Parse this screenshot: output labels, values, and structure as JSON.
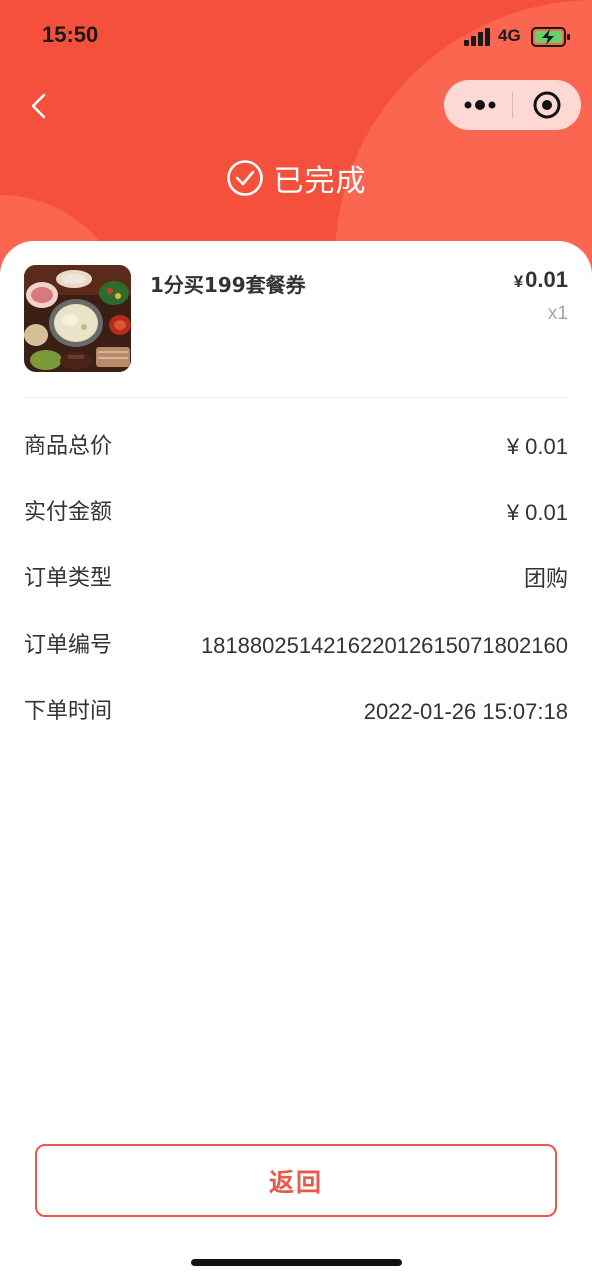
{
  "status_bar": {
    "time": "15:50",
    "network": "4G",
    "icons": [
      "signal-icon",
      "battery-charging-icon"
    ]
  },
  "nav": {
    "back_icon": "chevron-left-icon",
    "more_icon": "more-dots-icon",
    "close_icon": "target-close-icon"
  },
  "order_status": {
    "icon": "check-circle-icon",
    "label": "已完成"
  },
  "product": {
    "name": "1分买199套餐券",
    "currency": "¥",
    "price": "0.01",
    "quantity": "x1",
    "image_icon": "hotpot-meal-image"
  },
  "details": [
    {
      "label": "商品总价",
      "value": "¥ 0.01"
    },
    {
      "label": "实付金额",
      "value": "¥ 0.01"
    },
    {
      "label": "订单类型",
      "value": "团购"
    },
    {
      "label": "订单编号",
      "value": "18188025142162201261507180216​0"
    },
    {
      "label": "下单时间",
      "value": "2022-01-26 15:07:18"
    }
  ],
  "actions": {
    "return_label": "返回"
  },
  "colors": {
    "header": "#f5503c",
    "header_blob": "#fb6651",
    "accent": "#e8594a",
    "text": "#333333",
    "muted": "#a6a6a6"
  }
}
